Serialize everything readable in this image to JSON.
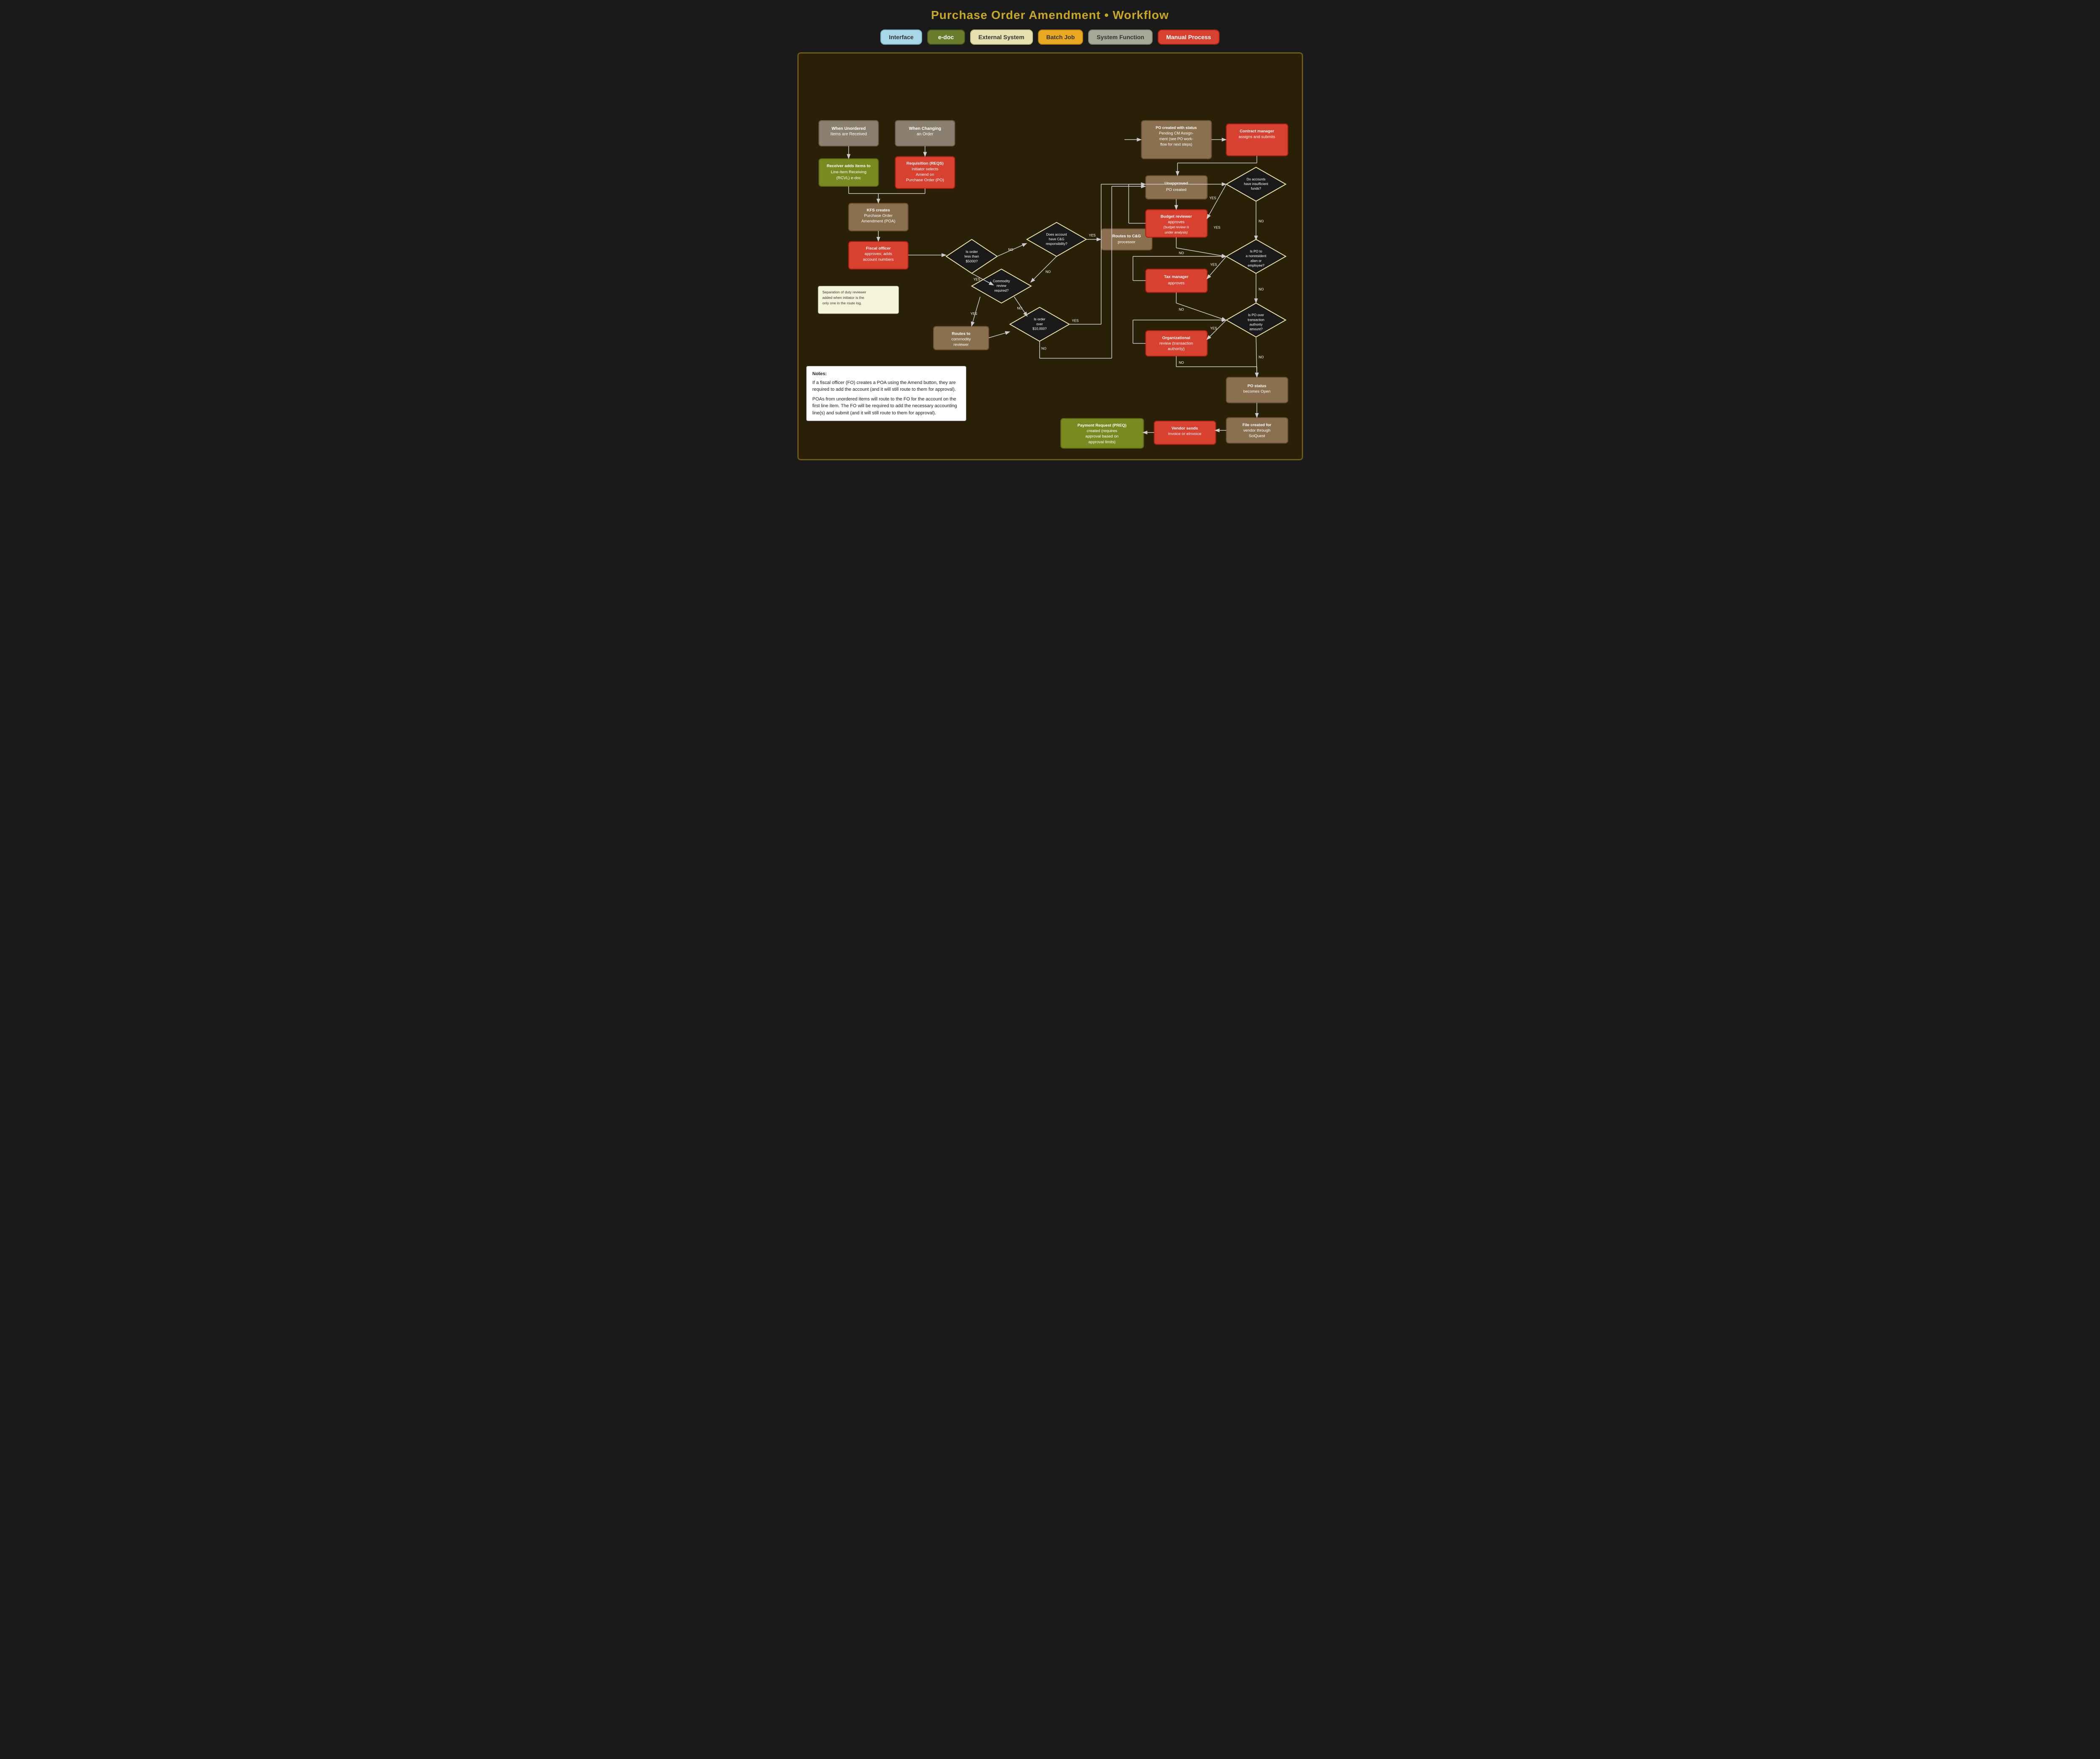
{
  "page": {
    "title": "Purchase Order Amendment • Workflow"
  },
  "legend": [
    {
      "id": "interface",
      "label": "Interface",
      "class": "legend-interface"
    },
    {
      "id": "edoc",
      "label": "e-doc",
      "class": "legend-edoc"
    },
    {
      "id": "external",
      "label": "External System",
      "class": "legend-external"
    },
    {
      "id": "batch",
      "label": "Batch Job",
      "class": "legend-batch"
    },
    {
      "id": "system",
      "label": "System Function",
      "class": "legend-system"
    },
    {
      "id": "manual",
      "label": "Manual Process",
      "class": "legend-manual"
    }
  ],
  "notes": {
    "title": "Notes:",
    "lines": [
      "If a fiscal officer (FO) creates a POA using the Amend button, they are required to add the account (and it will still route to them for approval).",
      "",
      "POAs from unordered items will route to the FO for the account on the first line item. The FO will be required to add the necessary accounting line(s) and submit (and it will still route to them for approval)."
    ]
  },
  "nodes": {
    "title": "Purchase Order Amendment • Workflow",
    "when_unordered": "When Unordered Items are Received",
    "when_changing": "When Changing an Order",
    "receiver_adds": "Receiver adds items to Line-Item Receiving (RCVL) e-doc",
    "requisition": "Requisition (REQS) initiator selects Amend on Purchase Order (PO)",
    "kfs_creates": "KFS creates Purchase Order Amendment (POA)",
    "fiscal_officer": "Fiscal officer approves; adds account numbers",
    "order_less_5000": "Is order less than $5000?",
    "does_account_cg": "Does account have C&G responsibility?",
    "routes_cg": "Routes to C&G processor",
    "commodity_review": "Commodity review required?",
    "routes_commodity": "Routes to commodity reviewer",
    "is_order_over": "Is order over $10,000?",
    "separation": "Separation of duty reviewer added when initiator is the only one in the route log.",
    "po_created_status": "PO created with status Pending CM Assignment (see PO workflow for next steps)",
    "contract_manager": "Contract manager assigns and submits",
    "unapproved_po": "Unapproved PO created",
    "budget_reviewer": "Budget reviewer approves (budget review is under analysis)",
    "do_accounts_insufficient": "Do accounts have insufficient funds?",
    "tax_manager": "Tax manager approves",
    "is_po_nonresident": "Is PO to a nonresident alien or employee?",
    "organizational_review": "Organizational review (transaction authority)",
    "is_po_over_transaction": "Is PO over transaction authority amount?",
    "po_status_open": "PO status becomes Open",
    "file_created": "File created for vendor through SciQuest",
    "vendor_sends": "Vendor sends invoice or eInvoice",
    "payment_request": "Payment Request (PREQ) created (requires approval based on approval limits)"
  }
}
